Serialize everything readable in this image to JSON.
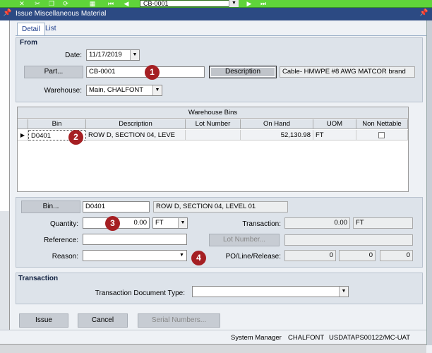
{
  "toolbar": {
    "part_combo_value": "CB-0001"
  },
  "window": {
    "title": "Issue Miscellaneous Material"
  },
  "tabs": [
    {
      "label": "Detail"
    },
    {
      "label": "List"
    }
  ],
  "from": {
    "section_title": "From",
    "date_label": "Date:",
    "date_value": "11/17/2019",
    "part_button": "Part...",
    "part_value": "CB-0001",
    "description_button": "Description",
    "description_value": "Cable- HMWPE #8  AWG MATCOR brand",
    "warehouse_label": "Warehouse:",
    "warehouse_value": "Main, CHALFONT"
  },
  "warehouse_bins": {
    "title": "Warehouse Bins",
    "columns": [
      "Bin",
      "Description",
      "Lot Number",
      "On Hand",
      "UOM",
      "Non Nettable"
    ],
    "rows": [
      {
        "bin": "D0401",
        "description": "ROW D, SECTION 04, LEVE",
        "lot_number": "",
        "on_hand": "52,130.98",
        "uom": "FT",
        "non_nettable": false
      }
    ]
  },
  "detail": {
    "bin_button": "Bin...",
    "bin_value": "D0401",
    "bin_description": "ROW D, SECTION 04, LEVEL 01",
    "quantity_label": "Quantity:",
    "quantity_value": "0.00",
    "quantity_uom": "FT",
    "reference_label": "Reference:",
    "reference_value": "",
    "reason_label": "Reason:",
    "reason_value": "",
    "transaction_label": "Transaction:",
    "transaction_value": "0.00",
    "transaction_uom": "FT",
    "lot_number_button": "Lot Number...",
    "lot_number_value": "",
    "po_label": "PO/Line/Release:",
    "po_value": "0",
    "line_value": "0",
    "release_value": "0"
  },
  "transaction": {
    "section_title": "Transaction",
    "doc_type_label": "Transaction Document Type:",
    "doc_type_value": ""
  },
  "buttons": {
    "issue": "Issue",
    "cancel": "Cancel",
    "serial_numbers": "Serial Numbers..."
  },
  "status": {
    "user": "System Manager",
    "site": "CHALFONT",
    "environment": "USDATAPS00122/MC-UAT"
  },
  "markers": [
    "1",
    "2",
    "3",
    "4"
  ],
  "colors": {
    "toolbar": "#5fd43a",
    "titlebar": "#2c4a83",
    "marker": "#a51f23"
  }
}
